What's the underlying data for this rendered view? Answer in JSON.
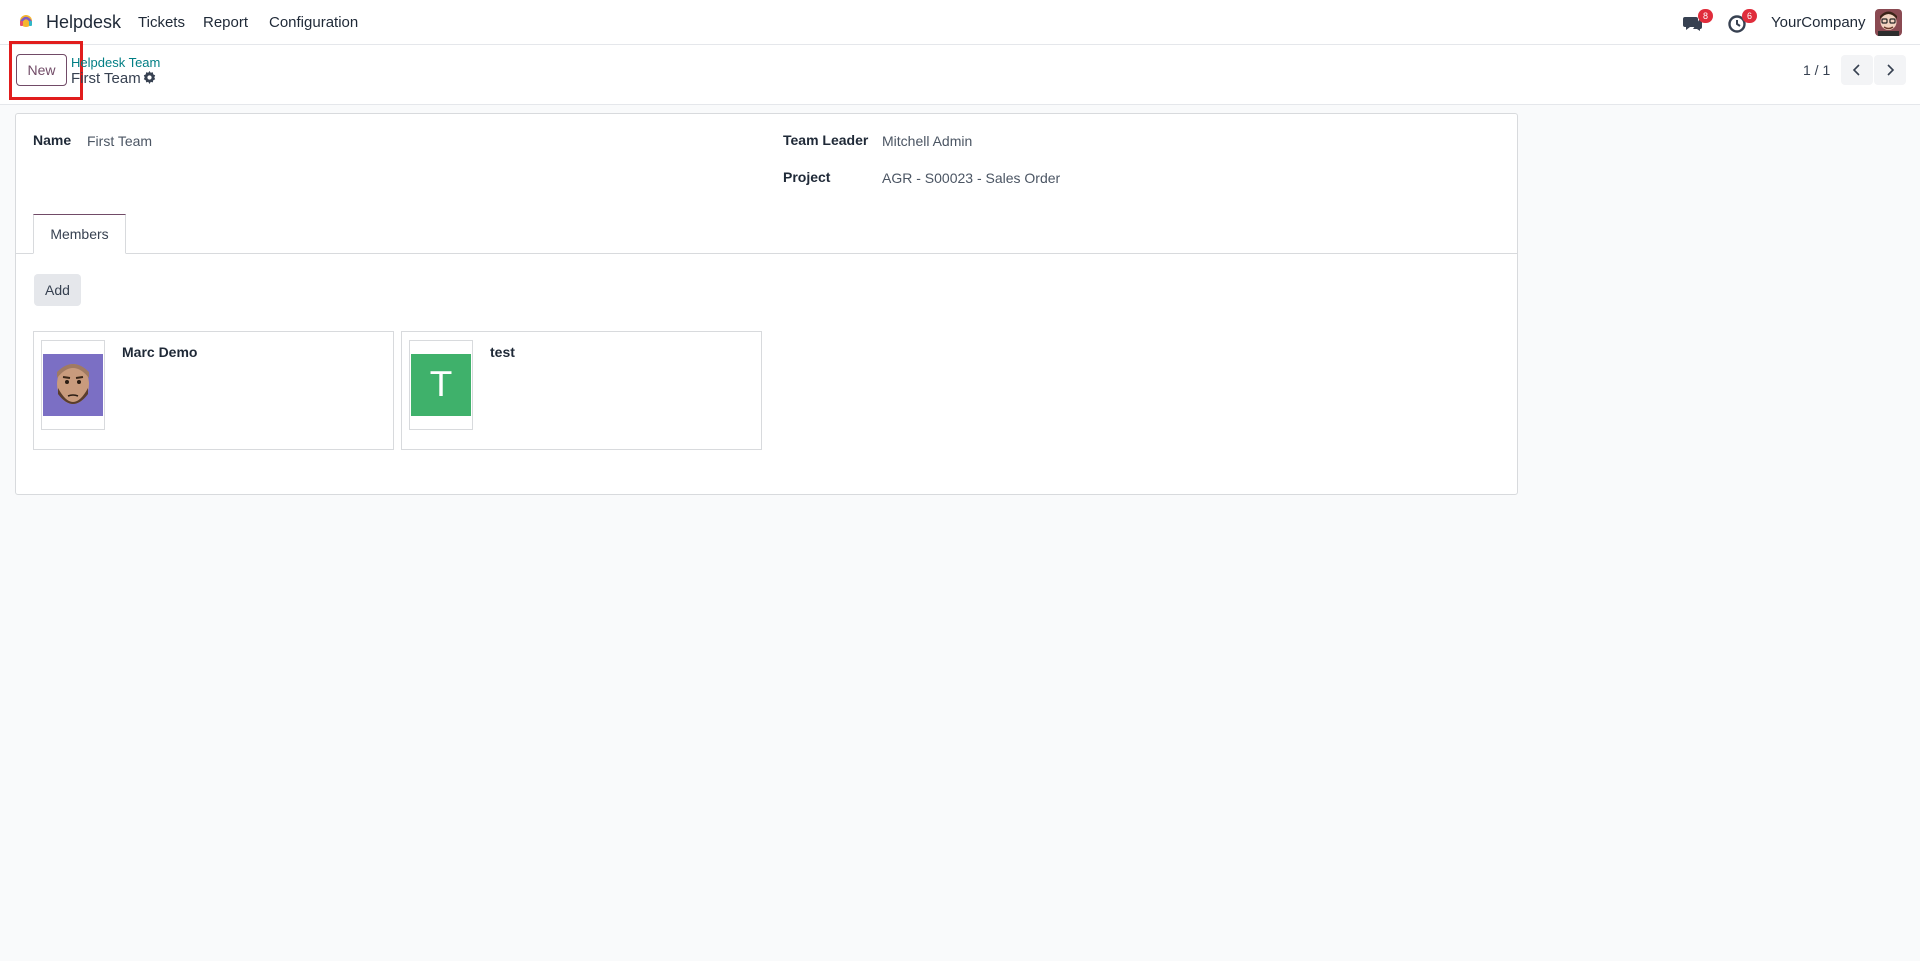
{
  "navbar": {
    "app_name": "Helpdesk",
    "menu": [
      "Tickets",
      "Report",
      "Configuration"
    ],
    "messages_badge": "8",
    "activities_badge": "6",
    "company": "YourCompany"
  },
  "control_panel": {
    "new_label": "New",
    "breadcrumb_parent": "Helpdesk Team",
    "record_title": "First Team",
    "pager_value": "1 / 1"
  },
  "form": {
    "name_label": "Name",
    "name_value": "First Team",
    "team_leader_label": "Team Leader",
    "team_leader_value": "Mitchell Admin",
    "project_label": "Project",
    "project_value": "AGR - S00023 - Sales Order"
  },
  "tabs": {
    "members_label": "Members"
  },
  "members": {
    "add_label": "Add",
    "items": [
      {
        "name": "Marc Demo"
      },
      {
        "name": "test",
        "initial": "T"
      }
    ]
  },
  "colors": {
    "brand": "#714b67",
    "link": "#017e84",
    "badge": "#e02d3c",
    "highlight": "#e11d1d",
    "avatar_green": "#3fb16b"
  }
}
